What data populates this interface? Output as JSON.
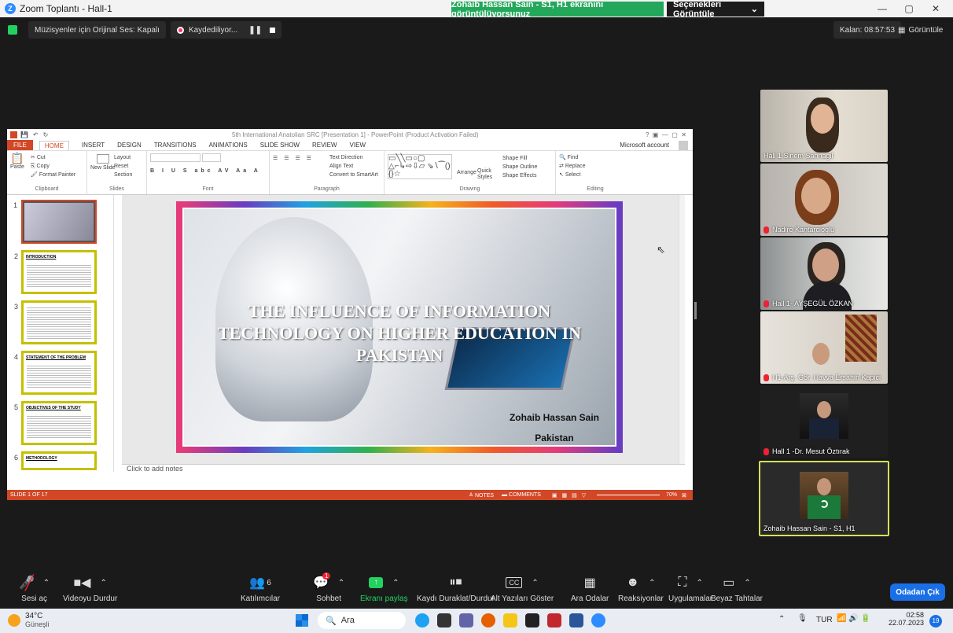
{
  "window": {
    "title": "Zoom Toplantı - Hall-1",
    "share_banner": "Zohaib Hassan Sain - S1, H1 ekranını görüntülüyorsunuz",
    "view_options": "Seçenekleri Görüntüle",
    "min": "—",
    "max": "▢",
    "close": "✕"
  },
  "topbar": {
    "audio_chip": "Müzisyenler için Orijinal Ses: Kapalı",
    "recording_chip": "Kaydediliyor...",
    "timer": "Kalan: 08:57:53",
    "view_button": "Görüntüle"
  },
  "ppt": {
    "title": "5th International Anatolian SRC [Presentation 1] - PowerPoint (Product Activation Failed)",
    "tabs": [
      "FILE",
      "HOME",
      "INSERT",
      "DESIGN",
      "TRANSITIONS",
      "ANIMATIONS",
      "SLIDE SHOW",
      "REVIEW",
      "VIEW"
    ],
    "account": "Microsoft account",
    "ribbon": {
      "clipboard": {
        "label": "Clipboard",
        "paste": "Paste",
        "cut": "Cut",
        "copy": "Copy",
        "format_painter": "Format Painter"
      },
      "slides": {
        "label": "Slides",
        "new_slide": "New Slide",
        "layout": "Layout",
        "reset": "Reset",
        "section": "Section"
      },
      "font": {
        "label": "Font"
      },
      "paragraph": {
        "label": "Paragraph",
        "text_direction": "Text Direction",
        "align_text": "Align Text",
        "convert": "Convert to SmartArt"
      },
      "drawing": {
        "label": "Drawing",
        "arrange": "Arrange",
        "quick_styles": "Quick Styles",
        "shape_fill": "Shape Fill",
        "shape_outline": "Shape Outline",
        "shape_effects": "Shape Effects"
      },
      "editing": {
        "label": "Editing",
        "find": "Find",
        "replace": "Replace",
        "select": "Select"
      }
    },
    "thumbs": [
      {
        "n": "1",
        "title": ""
      },
      {
        "n": "2",
        "title": "INTRODUCTION"
      },
      {
        "n": "3",
        "title": ""
      },
      {
        "n": "4",
        "title": "STATEMENT OF THE PROBLEM"
      },
      {
        "n": "5",
        "title": "OBJECTIVES OF THE STUDY"
      },
      {
        "n": "6",
        "title": "METHODOLOGY"
      }
    ],
    "slide": {
      "title_line1": "THE INFLUENCE OF INFORMATION",
      "title_line2": "TECHNOLOGY ON HIGHER EDUCATION IN",
      "title_line3": "PAKISTAN",
      "author": "Zohaib Hassan Sain",
      "country": "Pakistan"
    },
    "notes_placeholder": "Click to add notes",
    "status": {
      "slide_count": "SLIDE 1 OF 17",
      "notes": "NOTES",
      "comments": "COMMENTS",
      "zoom": "70%"
    }
  },
  "participants": [
    {
      "name": "Hall 1 Sinem Şahnagil",
      "muted": false
    },
    {
      "name": "Nadire Kantarcioglu",
      "muted": true
    },
    {
      "name": "Hall 1- AYŞEGÜL ÖZKAN",
      "muted": true
    },
    {
      "name": "H1-Arş. Gör. Havva Ersahin Kapici",
      "muted": true
    },
    {
      "name": "Hall 1 -Dr. Mesut Öztırak",
      "muted": true
    },
    {
      "name": "Zohaib Hassan Sain - S1, H1",
      "muted": false
    }
  ],
  "toolbar": {
    "unmute": "Sesi aç",
    "stop_video": "Videoyu Durdur",
    "participants": "Katılımcılar",
    "participants_count": "6",
    "chat": "Sohbet",
    "chat_badge": "1",
    "share": "Ekranı paylaş",
    "pause_record": "Kaydı Duraklat/Durdur",
    "captions": "Alt Yazıları Göster",
    "cc": "CC",
    "breakout": "Ara Odalar",
    "reactions": "Reaksiyonlar",
    "apps": "Uygulamalar",
    "whiteboard": "Beyaz Tahtalar",
    "leave": "Odadan Çık"
  },
  "taskbar": {
    "temp": "34°C",
    "weather": "Güneşli",
    "search": "Ara",
    "lang": "TUR",
    "time": "02:58",
    "date": "22.07.2023",
    "notif": "19"
  },
  "colors": {
    "ppt_accent": "#d24726",
    "share_green": "#23a75a",
    "zoom_blue": "#1a6fe6",
    "active_speaker": "#d4e157"
  }
}
